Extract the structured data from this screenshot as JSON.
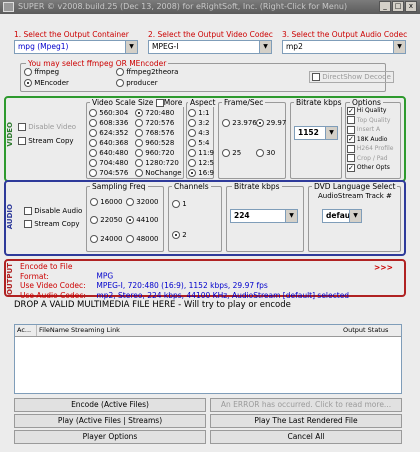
{
  "window": {
    "title": "SUPER © v2008.build.25 (Dec 13, 2008) for eRightSoft, Inc. (Right-Click for Menu)",
    "controls": [
      "_",
      "□",
      "x"
    ]
  },
  "step1": {
    "number": "1.",
    "label": "Select the Output Container",
    "value": "mpg  (Mpeg1)"
  },
  "step2": {
    "number": "2.",
    "label": "Select the Output Video Codec",
    "value": "MPEG-I"
  },
  "step3": {
    "number": "3.",
    "label": "Select the Output Audio Codec",
    "value": "mp2"
  },
  "encoder": {
    "title": "You may select ffmpeg OR MEncoder",
    "options": [
      "ffmpeg",
      "ffmpeg2theora",
      "MEncoder",
      "producer"
    ],
    "selected": "MEncoder",
    "direct_show_label": "DirectShow Decode"
  },
  "video": {
    "section_label": "VIDEO",
    "disable_label": "Disable Video",
    "stream_copy_label": "Stream Copy",
    "scale": {
      "title": "Video Scale Size",
      "more_label": "More",
      "col1": [
        "560:304",
        "608:336",
        "624:352",
        "640:368",
        "640:480",
        "704:480",
        "704:576"
      ],
      "col2": [
        "720:480",
        "720:576",
        "768:576",
        "960:528",
        "960:720",
        "1280:720",
        "NoChange"
      ],
      "selected": "720:480"
    },
    "aspect": {
      "title": "Aspect",
      "options": [
        "1:1",
        "3:2",
        "4:3",
        "5:4",
        "11:9",
        "12:5",
        "16:9"
      ],
      "selected": "16:9"
    },
    "frame": {
      "title": "Frame/Sec",
      "options": [
        "23.976",
        "29.97",
        "25",
        "30"
      ],
      "selected": "29.97"
    },
    "bitrate": {
      "title": "Bitrate  kbps",
      "value": "1152"
    },
    "options": {
      "title": "Options",
      "items": [
        {
          "label": "Hi Quality",
          "checked": true,
          "enabled": true
        },
        {
          "label": "Top Quality",
          "checked": false,
          "enabled": false
        },
        {
          "label": "Insert A",
          "checked": false,
          "enabled": false
        },
        {
          "label": "18K Audio",
          "checked": true,
          "enabled": true
        },
        {
          "label": "H264 Profile",
          "checked": false,
          "enabled": false
        },
        {
          "label": "Crop / Pad",
          "checked": false,
          "enabled": false
        },
        {
          "label": "Other Opts",
          "checked": true,
          "enabled": true
        }
      ]
    }
  },
  "audio": {
    "section_label": "AUDIO",
    "disable_label": "Disable Audio",
    "stream_copy_label": "Stream Copy",
    "sampling": {
      "title": "Sampling Freq",
      "col1": [
        "16000",
        "22050",
        "24000"
      ],
      "col2": [
        "32000",
        "44100",
        "48000"
      ],
      "selected": "44100"
    },
    "channels": {
      "title": "Channels",
      "options": [
        "1",
        "2"
      ],
      "selected": "2"
    },
    "bitrate": {
      "title": "Bitrate  kbps",
      "value": "224"
    },
    "dvd": {
      "title": "DVD Language Select",
      "subtitle": "AudioStream  Track #",
      "value": "default"
    }
  },
  "output": {
    "section_label": "OUTPUT",
    "lines": [
      {
        "label": "Encode to File Format:",
        "value": "MPG"
      },
      {
        "label": "Use Video Codec:",
        "value": "MPEG-I,  720:480 (16:9),  1152 kbps,  29.97 fps"
      },
      {
        "label": "Use Audio Codec:",
        "value": "mp2,  Stereo,  224 kbps,  44100 KHz,  AudioStream [default] selected"
      }
    ],
    "more_marker": ">>>"
  },
  "drop_text": "DROP A VALID MULTIMEDIA FILE HERE - Will try to play or encode",
  "file_list": {
    "columns": [
      "Ac...",
      "FileName",
      "Streaming Link",
      "Output Status"
    ]
  },
  "buttons": {
    "encode": "Encode (Active Files)",
    "error": "An ERROR has occurred. Click to read more...",
    "play_active": "Play (Active Files | Streams)",
    "play_last": "Play The Last Rendered File",
    "player_options": "Player Options",
    "cancel_all": "Cancel All"
  },
  "colors": {
    "video_border": "#2e9a2e",
    "audio_border": "#2e3a9a",
    "output_border": "#b02222",
    "step_red": "#cc0000",
    "value_blue": "#0000cc"
  }
}
